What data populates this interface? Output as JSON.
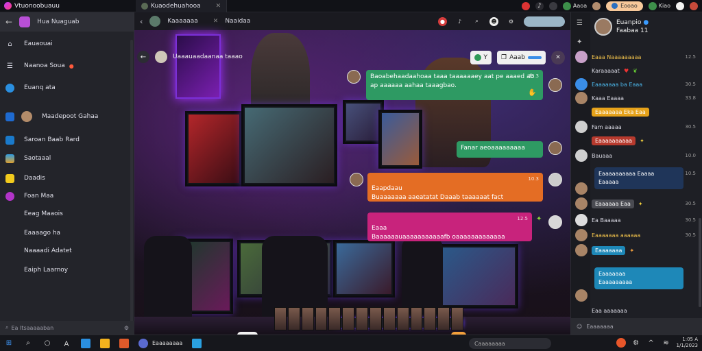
{
  "titlebar": {
    "app_name": "Vtuonoobuauu",
    "tab_label": "Kuaodehuahooa",
    "right_pill": "Eooao",
    "right_item_1": "Aaoa",
    "right_item_2": "Kiao"
  },
  "sidebar": {
    "header_label": "Hua Nuaguab",
    "items": [
      {
        "label": "Eauaouai"
      },
      {
        "label": "Naanoa Soua",
        "badge": "●"
      },
      {
        "label": "Euanq ata"
      },
      {
        "label": "Maadepoot Gahaa"
      },
      {
        "label": "Saroan Baab Rard"
      },
      {
        "label": "Saotaaal"
      },
      {
        "label": "Daadis"
      },
      {
        "label": "Foan Maa"
      },
      {
        "label": "Eeag Maaois"
      },
      {
        "label": "Eaaaago ha"
      },
      {
        "label": "Naaaadi Adatet"
      },
      {
        "label": "Eaiph Laarnoy"
      }
    ],
    "search_placeholder": "Ea Itsaaaaaban"
  },
  "main": {
    "header_title": "Kaaaaaaa",
    "header_tab": "Naaidaa",
    "sub_title": "Uaaauaadaanaa taaao",
    "action_1": "Y",
    "action_2": "Aaab",
    "messages": [
      {
        "text": "Baoabehaadaahoaa taaa taaaaaaey aat pe aaaed ab ap aaaaaa aahaa taaagbao.",
        "time": "33.3",
        "color": "#2e9a63"
      },
      {
        "text": "Fanar aeoaaaaaaaaa",
        "time": "",
        "color": "#2e9a63"
      },
      {
        "text": "Eaapdaau\nBuaaaaaaa aaeatatat Daaab taaaaaat fact",
        "time": "10.3",
        "color": "#e46d24"
      },
      {
        "text": "Eaaa\nBaaaaaauaaaaaaaaaaafb oaaaaaaaaaaaaa",
        "time": "12.5",
        "color": "#c8237c"
      }
    ]
  },
  "right_panel": {
    "profile_name": "Euanpio",
    "profile_sub": "Faabaa 11",
    "messages": [
      {
        "name": "Eaaa Naaaaaaaaa",
        "time": "12.5"
      },
      {
        "name": "Karaaaaat",
        "time": ""
      },
      {
        "name": "Eaaaaaaa ba Eaaa",
        "time": "30.5"
      },
      {
        "name": "Kaaa Eaaaa",
        "time": "33.8"
      },
      {
        "name": "Eaaaaaaaa",
        "tag": "Efd Eaaaa",
        "time": ""
      },
      {
        "name": "Fam aaaaa",
        "time": "30.5"
      },
      {
        "name": "Bauaaa",
        "time": "10.0"
      },
      {
        "name": "Eaaaaaaaa aaaaa",
        "time": "10.5"
      },
      {
        "name": "Eaaaaa",
        "time": ""
      },
      {
        "name": "Eaaaaaaa aaa",
        "time": "30.5"
      },
      {
        "name": "Ea Baaaaa",
        "time": "30.5"
      },
      {
        "name": "Eaaaaaaa aaaaaa",
        "time": "30.5"
      },
      {
        "name": "Eaaaaaaa",
        "time": ""
      },
      {
        "name": "Eaaaaaaaaa",
        "time": ""
      },
      {
        "name": "Eaa aaaaaaa",
        "time": "10.0"
      }
    ],
    "tag_yellow": "Eaaaaaaa Eka Eaa",
    "tag_red": "Eaaaaaaaaaa",
    "tag_grey": "Eaaaaaa Eaa",
    "card_1_line1": "Eaaaaaaaaaa Eaaaa",
    "card_1_line2": "Eaaaaa",
    "card_2_line1": "Eaaaaaaa",
    "card_2_line2": "Eaaaaaaaaa",
    "search_placeholder": "Eaaaaaaa"
  },
  "taskbar": {
    "app_label": "Eaaaaaaaa",
    "search_placeholder": "Caaaaaaaa",
    "clock_time": "1:05 A",
    "clock_date": "1/1/2023"
  }
}
